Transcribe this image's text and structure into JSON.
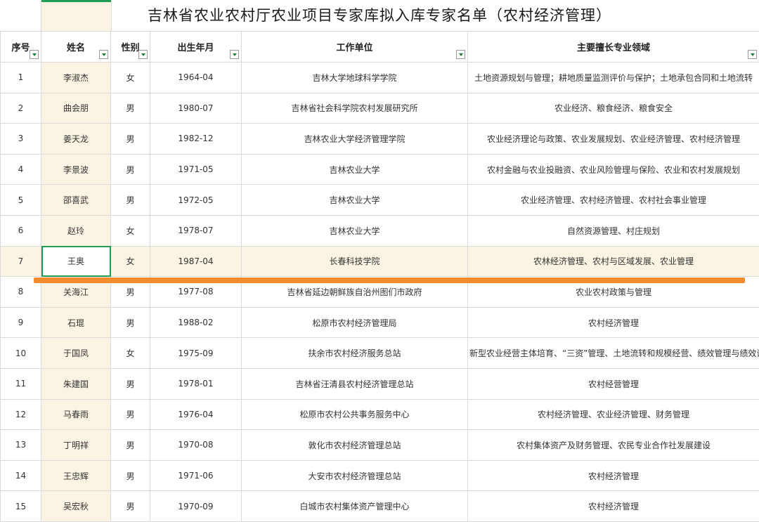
{
  "title": "吉林省农业农村厅农业项目专家库拟入库专家名单（农村经济管理）",
  "headers": {
    "seq": "序号",
    "name": "姓名",
    "gender": "性别",
    "birth": "出生年月",
    "unit": "工作单位",
    "field": "主要擅长专业领域"
  },
  "rows": [
    {
      "seq": "1",
      "name": "李淑杰",
      "gender": "女",
      "birth": "1964-04",
      "unit": "吉林大学地球科学学院",
      "field": "土地资源规划与管理；耕地质量监测评价与保护；土地承包合同和土地流转"
    },
    {
      "seq": "2",
      "name": "曲会朋",
      "gender": "男",
      "birth": "1980-07",
      "unit": "吉林省社会科学院农村发展研究所",
      "field": "农业经济、粮食经济、粮食安全"
    },
    {
      "seq": "3",
      "name": "姜天龙",
      "gender": "男",
      "birth": "1982-12",
      "unit": "吉林农业大学经济管理学院",
      "field": "农业经济理论与政策、农业发展规划、农业经济管理、农村经济管理"
    },
    {
      "seq": "4",
      "name": "李景波",
      "gender": "男",
      "birth": "1971-05",
      "unit": "吉林农业大学",
      "field": "农村金融与农业投融资、农业风险管理与保险、农业和农村发展规划"
    },
    {
      "seq": "5",
      "name": "邵喜武",
      "gender": "男",
      "birth": "1972-05",
      "unit": "吉林农业大学",
      "field": "农业经济管理、农村经济管理、农村社会事业管理"
    },
    {
      "seq": "6",
      "name": "赵玲",
      "gender": "女",
      "birth": "1978-07",
      "unit": "吉林农业大学",
      "field": "自然资源管理、村庄规划"
    },
    {
      "seq": "7",
      "name": "王奥",
      "gender": "女",
      "birth": "1987-04",
      "unit": "长春科技学院",
      "field": "农林经济管理、农村与区域发展、农业管理"
    },
    {
      "seq": "8",
      "name": "关海江",
      "gender": "男",
      "birth": "1977-08",
      "unit": "吉林省延边朝鲜族自治州图们市政府",
      "field": "农业农村政策与管理"
    },
    {
      "seq": "9",
      "name": "石琨",
      "gender": "男",
      "birth": "1988-02",
      "unit": "松原市农村经济管理局",
      "field": "农村经济管理"
    },
    {
      "seq": "10",
      "name": "于国凤",
      "gender": "女",
      "birth": "1975-09",
      "unit": "扶余市农村经济服务总站",
      "field": "新型农业经营主体培育、“三资”管理、土地流转和规模经营、绩效管理与绩效评价、农业统计"
    },
    {
      "seq": "11",
      "name": "朱建国",
      "gender": "男",
      "birth": "1978-01",
      "unit": "吉林省汪清县农村经济管理总站",
      "field": "农村经营管理"
    },
    {
      "seq": "12",
      "name": "马春雨",
      "gender": "男",
      "birth": "1976-04",
      "unit": "松原市农村公共事务服务中心",
      "field": "农村经济管理、农业经济管理、财务管理"
    },
    {
      "seq": "13",
      "name": "丁明祥",
      "gender": "男",
      "birth": "1970-08",
      "unit": "敦化市农村经济管理总站",
      "field": "农村集体资产及财务管理、农民专业合作社发展建设"
    },
    {
      "seq": "14",
      "name": "王忠辉",
      "gender": "男",
      "birth": "1971-06",
      "unit": "大安市农村经济管理总站",
      "field": "农村经济管理"
    },
    {
      "seq": "15",
      "name": "吴宏秋",
      "gender": "男",
      "birth": "1970-09",
      "unit": "白城市农村集体资产管理中心",
      "field": "农村经济管理"
    }
  ],
  "colors": {
    "selection": "#1f9d55",
    "column_highlight": "#fbf4e4",
    "annotation_line": "#f58b2c"
  },
  "icons": [
    "filter-dropdown-icon"
  ]
}
